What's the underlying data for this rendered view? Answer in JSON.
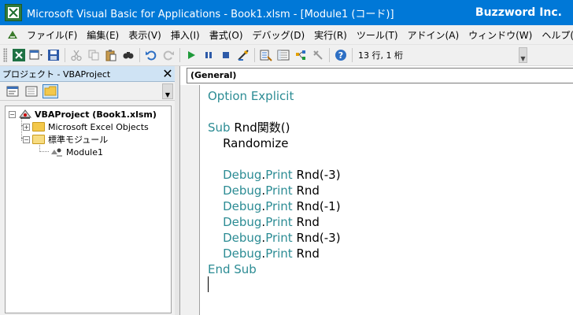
{
  "window": {
    "title": "Microsoft Visual Basic for Applications - Book1.xlsm - [Module1 (コード)]",
    "brand": "Buzzword Inc."
  },
  "menu": {
    "items": [
      "ファイル(F)",
      "編集(E)",
      "表示(V)",
      "挿入(I)",
      "書式(O)",
      "デバッグ(D)",
      "実行(R)",
      "ツール(T)",
      "アドイン(A)",
      "ウィンドウ(W)",
      "ヘルプ(H)"
    ]
  },
  "toolbar": {
    "position": "13 行, 1 桁"
  },
  "project": {
    "title": "プロジェクト - VBAProject",
    "close": "✕",
    "tree": {
      "root": "VBAProject (Book1.xlsm)",
      "excel_objects": "Microsoft Excel Objects",
      "std_modules": "標準モジュール",
      "module": "Module1"
    }
  },
  "code": {
    "combo": "(General)",
    "lines": [
      [
        {
          "t": "Option Explicit",
          "k": true
        }
      ],
      [],
      [
        {
          "t": "Sub",
          "k": true
        },
        {
          "t": " Rnd関数()",
          "k": false
        }
      ],
      [
        {
          "t": "    Randomize",
          "k": false
        }
      ],
      [],
      [
        {
          "t": "    Debug",
          "k": true
        },
        {
          "t": ".",
          "k": false
        },
        {
          "t": "Print",
          "k": true
        },
        {
          "t": " Rnd(-3)",
          "k": false
        }
      ],
      [
        {
          "t": "    Debug",
          "k": true
        },
        {
          "t": ".",
          "k": false
        },
        {
          "t": "Print",
          "k": true
        },
        {
          "t": " Rnd",
          "k": false
        }
      ],
      [
        {
          "t": "    Debug",
          "k": true
        },
        {
          "t": ".",
          "k": false
        },
        {
          "t": "Print",
          "k": true
        },
        {
          "t": " Rnd(-1)",
          "k": false
        }
      ],
      [
        {
          "t": "    Debug",
          "k": true
        },
        {
          "t": ".",
          "k": false
        },
        {
          "t": "Print",
          "k": true
        },
        {
          "t": " Rnd",
          "k": false
        }
      ],
      [
        {
          "t": "    Debug",
          "k": true
        },
        {
          "t": ".",
          "k": false
        },
        {
          "t": "Print",
          "k": true
        },
        {
          "t": " Rnd(-3)",
          "k": false
        }
      ],
      [
        {
          "t": "    Debug",
          "k": true
        },
        {
          "t": ".",
          "k": false
        },
        {
          "t": "Print",
          "k": true
        },
        {
          "t": " Rnd",
          "k": false
        }
      ],
      [
        {
          "t": "End Sub",
          "k": true
        }
      ]
    ],
    "keyword_color": "#2c8c94"
  }
}
